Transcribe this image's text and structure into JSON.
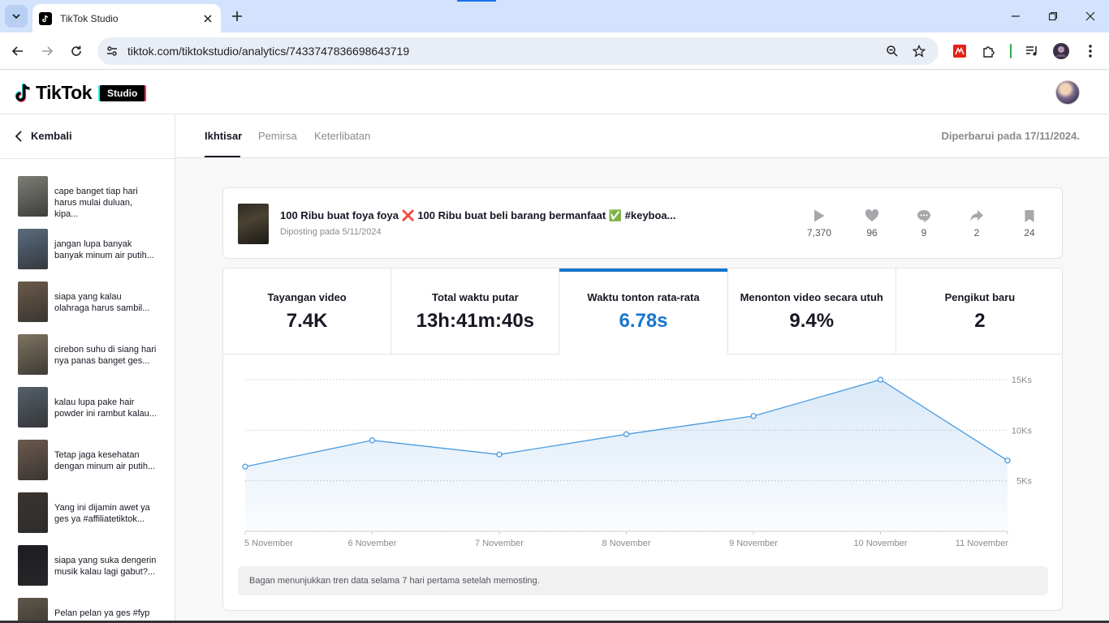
{
  "browser": {
    "tab_title": "TikTok Studio",
    "url": "tiktok.com/tiktokstudio/analytics/7433747836698643719"
  },
  "header": {
    "brand": "TikTok",
    "badge": "Studio"
  },
  "sidebar": {
    "back_label": "Kembali",
    "videos": [
      {
        "caption": "cape banget tiap hari harus mulai duluan, kipa...",
        "color": "#7c7f76"
      },
      {
        "caption": "jangan lupa banyak banyak minum air putih...",
        "color": "#5a6b7f"
      },
      {
        "caption": "siapa yang kalau olahraga harus sambil...",
        "color": "#6b5a4a"
      },
      {
        "caption": "cirebon suhu di siang hari nya panas banget ges...",
        "color": "#7e7460"
      },
      {
        "caption": "kalau lupa pake hair powder ini rambut kalau...",
        "color": "#55606a"
      },
      {
        "caption": "Tetap jaga kesehatan dengan minum air putih...",
        "color": "#6d5a4e"
      },
      {
        "caption": "Yang ini dijamin awet ya ges ya #affiliatetiktok...",
        "color": "#3a3430"
      },
      {
        "caption": "siapa yang suka dengerin musik kalau lagi gabut?...",
        "color": "#1e1c22"
      },
      {
        "caption": "Pelan pelan ya ges #fyp",
        "color": "#5e5648"
      }
    ]
  },
  "subnav": {
    "tabs": [
      "Ikhtisar",
      "Pemirsa",
      "Keterlibatan"
    ],
    "active_tab": "Ikhtisar",
    "updated": "Diperbarui pada 17/11/2024."
  },
  "post": {
    "title": "100 Ribu buat foya foya ❌ 100 Ribu buat beli barang bermanfaat ✅ #keyboa...",
    "date": "Diposting pada 5/11/2024",
    "stats": {
      "views": "7,370",
      "likes": "96",
      "comments": "9",
      "shares": "2",
      "saves": "24"
    }
  },
  "metrics": [
    {
      "label": "Tayangan video",
      "value": "7.4K"
    },
    {
      "label": "Total waktu putar",
      "value": "13h:41m:40s"
    },
    {
      "label": "Waktu tonton rata-rata",
      "value": "6.78s"
    },
    {
      "label": "Menonton video secara utuh",
      "value": "9.4%"
    },
    {
      "label": "Pengikut baru",
      "value": "2"
    }
  ],
  "selected_metric": 2,
  "accent_color": "#1775cf",
  "chart_data": {
    "type": "area",
    "categories": [
      "5 November",
      "6 November",
      "7 November",
      "8 November",
      "9 November",
      "10 November",
      "11 November"
    ],
    "values": [
      6.4,
      9.0,
      7.6,
      9.6,
      11.4,
      15.0,
      7.0
    ],
    "y_ticks": [
      "5Ks",
      "10Ks",
      "15Ks"
    ],
    "y_tick_values": [
      5,
      10,
      15
    ],
    "ylim": [
      0,
      15
    ],
    "grid": true
  },
  "note": "Bagan menunjukkan tren data selama 7 hari pertama setelah memosting."
}
